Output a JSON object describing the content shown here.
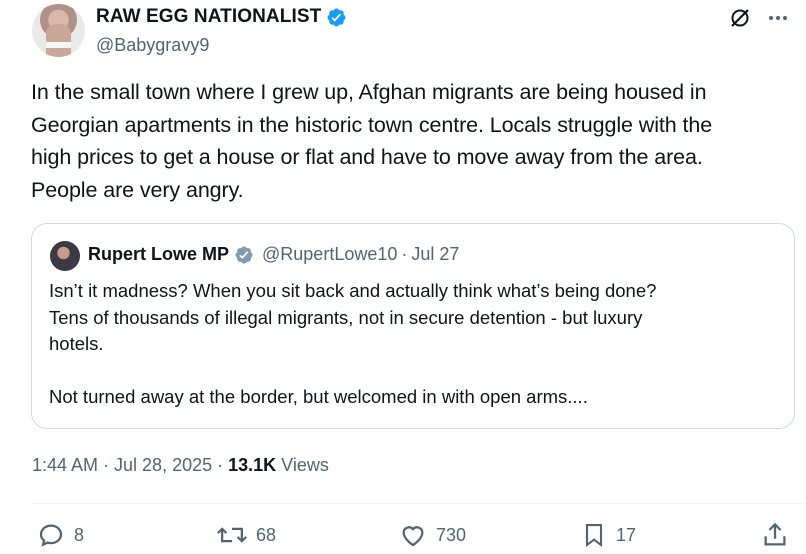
{
  "author": {
    "display_name": "RAW EGG NATIONALIST",
    "handle": "@Babygravy9"
  },
  "tweet": {
    "text": "In the small town where I grew up, Afghan migrants are being housed in\nGeorgian apartments in the historic town centre. Locals struggle with the\nhigh prices to get a house or flat and have to move away from the area.\nPeople are very angry."
  },
  "quote": {
    "display_name": "Rupert Lowe MP",
    "handle": "@RupertLowe10",
    "separator": "·",
    "date": "Jul 27",
    "text": "Isn’t it madness? When you sit back and actually think what’s being done?\nTens of thousands of illegal migrants, not in secure detention - but luxury\nhotels.\n\nNot turned away at the border, but welcomed in with open arms...."
  },
  "meta": {
    "timestamp": "1:44 AM · Jul 28, 2025 ·",
    "views_count": "13.1K",
    "views_label": "Views"
  },
  "actions": {
    "replies": "8",
    "reposts": "68",
    "likes": "730",
    "bookmarks": "17"
  },
  "colors": {
    "verified_blue": "#1d9bf0",
    "quote_verified_gray": "#829aab",
    "secondary_text": "#536471",
    "border": "#cfd9de"
  },
  "icons": {
    "top": [
      "grok-icon",
      "more-icon"
    ],
    "actions": [
      "reply-icon",
      "repost-icon",
      "like-icon",
      "bookmark-icon",
      "share-icon"
    ]
  }
}
